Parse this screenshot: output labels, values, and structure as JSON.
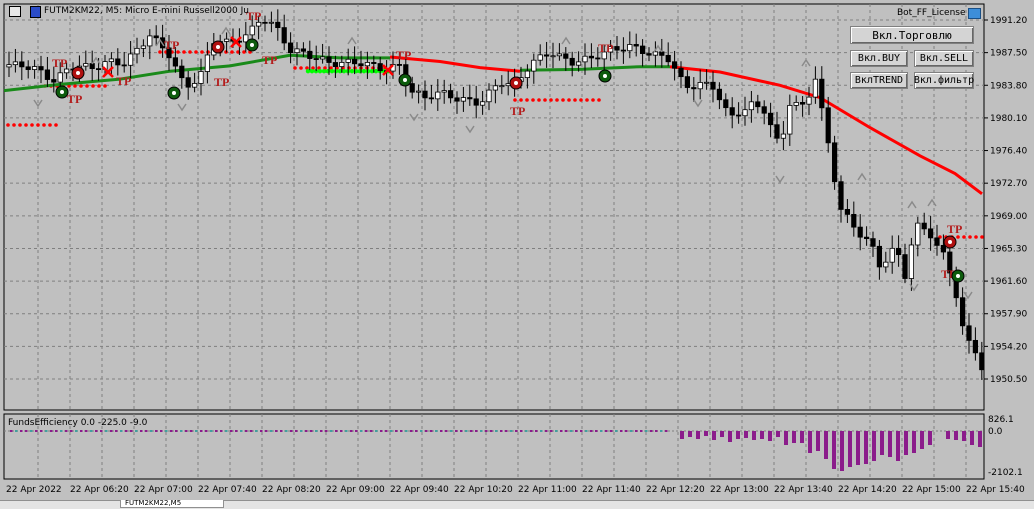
{
  "window": {
    "title": "FUTM2KM22, M5:  Micro E-mini Russell2000 Ju",
    "license_label": "Bot_FF_License",
    "bottom_tab": "FUTM2KM22,M5"
  },
  "buttons": {
    "trade": "Вкл.Торговлю",
    "buy": "Вкл.BUY",
    "sell": "Вкл.SELL",
    "trend": "ВклTREND",
    "filter": "Вкл.фильтр"
  },
  "price_axis": [
    "1991.20",
    "1987.50",
    "1983.80",
    "1980.10",
    "1976.40",
    "1972.70",
    "1969.00",
    "1965.30",
    "1961.60",
    "1957.90",
    "1954.20",
    "1950.50"
  ],
  "time_axis": [
    "22 Apr 2022",
    "22 Apr 06:20",
    "22 Apr 07:00",
    "22 Apr 07:40",
    "22 Apr 08:20",
    "22 Apr 09:00",
    "22 Apr 09:40",
    "22 Apr 10:20",
    "22 Apr 11:00",
    "22 Apr 11:40",
    "22 Apr 12:20",
    "22 Apr 13:00",
    "22 Apr 13:40",
    "22 Apr 14:20",
    "22 Apr 15:00",
    "22 Apr 15:40"
  ],
  "indicator": {
    "label": "FundsEfficiency 0.0 -225.0 -9.0",
    "axis": [
      "826.1",
      "0.0",
      "-2102.1"
    ]
  },
  "tp_label": "TP",
  "colors": {
    "background": "#c0c0c0",
    "grid": "#7f7f7f",
    "bull_candle": "#ffffff",
    "bear_candle": "#000000",
    "ma_green": "#1a8a1a",
    "ma_red": "#ff0000",
    "tp_text": "#b41e1e",
    "histogram": "#8b1c8b",
    "signal_green": "#00ff00"
  }
}
